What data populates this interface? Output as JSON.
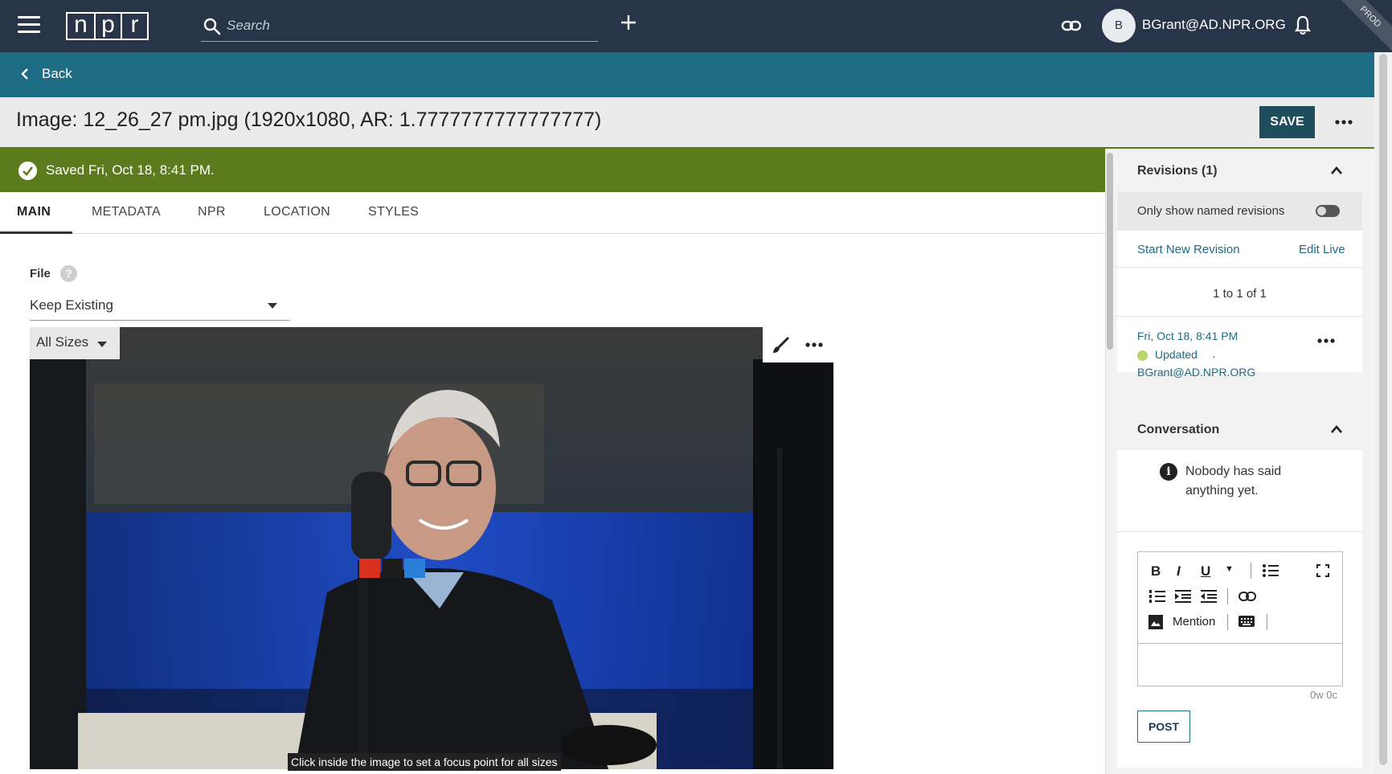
{
  "header": {
    "search_placeholder": "Search",
    "user_initial": "B",
    "user_name": "BGrant@AD.NPR.ORG",
    "env_badge": "PROD",
    "logo_letters": [
      "n",
      "p",
      "r"
    ]
  },
  "backbar": {
    "back_label": "Back"
  },
  "titlebar": {
    "title": "Image: 12_26_27 pm.jpg (1920x1080, AR: 1.7777777777777777)",
    "save_label": "SAVE"
  },
  "banner": {
    "saved_text": "Saved Fri, Oct 18, 8:41 PM."
  },
  "tabs": [
    {
      "label": "MAIN",
      "active": true
    },
    {
      "label": "METADATA",
      "active": false
    },
    {
      "label": "NPR",
      "active": false
    },
    {
      "label": "LOCATION",
      "active": false
    },
    {
      "label": "STYLES",
      "active": false
    }
  ],
  "main": {
    "file_label": "File",
    "file_select_value": "Keep Existing",
    "sizes_select_value": "All Sizes",
    "focus_hint": "Click inside the image to set a focus point for all sizes"
  },
  "revisions": {
    "heading": "Revisions (1)",
    "named_toggle_label": "Only show named revisions",
    "named_toggle_on": false,
    "start_new": "Start New Revision",
    "edit_live": "Edit Live",
    "pager": "1 to 1 of 1",
    "items": [
      {
        "date": "Fri, Oct 18, 8:41 PM",
        "status": "Updated",
        "user": "BGrant@AD.NPR.ORG",
        "status_color": "#b9d66a"
      }
    ]
  },
  "conversation": {
    "heading": "Conversation",
    "empty_message": "Nobody has said anything yet.",
    "mention_label": "Mention",
    "counter": "0w 0c",
    "post_label": "POST"
  },
  "colors": {
    "topbar": "#283548",
    "backbar": "#1e6b84",
    "saved_banner": "#5c7b1c",
    "save_button": "#1f4d5e"
  }
}
